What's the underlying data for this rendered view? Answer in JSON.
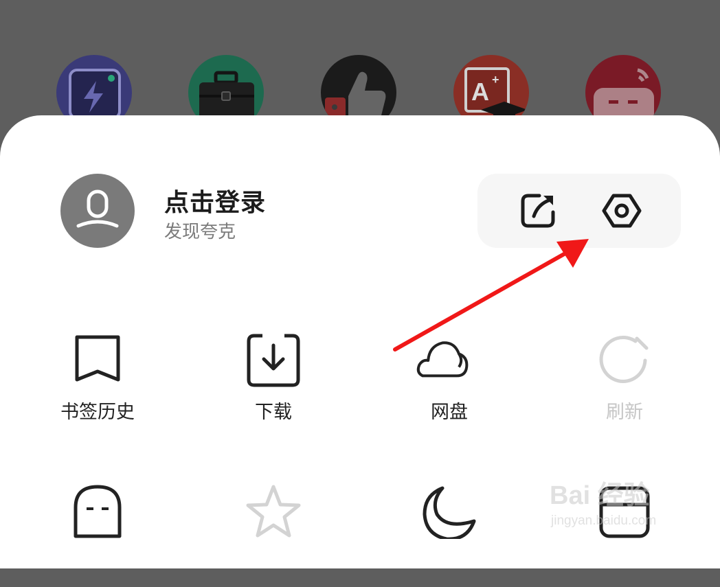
{
  "background_apps": [
    {
      "name": "flash-app-icon",
      "color": "#3a3a78"
    },
    {
      "name": "briefcase-app-icon",
      "color": "#1d6a4f"
    },
    {
      "name": "thumbs-up-app-icon",
      "color": "#1b1b1b"
    },
    {
      "name": "grade-app-icon",
      "color": "#8a2e25"
    },
    {
      "name": "tv-app-icon",
      "color": "#7a1a26"
    }
  ],
  "profile": {
    "title": "点击登录",
    "subtitle": "发现夸克"
  },
  "quick_actions": [
    {
      "icon": "share-export-icon"
    },
    {
      "icon": "settings-hex-icon"
    }
  ],
  "grid_row1": [
    {
      "label": "书签历史",
      "icon": "bookmark-icon",
      "enabled": true
    },
    {
      "label": "下载",
      "icon": "download-icon",
      "enabled": true
    },
    {
      "label": "网盘",
      "icon": "cloud-icon",
      "enabled": true
    },
    {
      "label": "刷新",
      "icon": "refresh-icon",
      "enabled": false
    }
  ],
  "grid_row2": [
    {
      "icon": "ghost-incognito-icon",
      "enabled": true
    },
    {
      "icon": "star-icon",
      "enabled": false
    },
    {
      "icon": "moon-icon",
      "enabled": true
    },
    {
      "icon": "window-icon",
      "enabled": true
    }
  ],
  "colors": {
    "overlay": "#5e5e5e",
    "sheet": "#ffffff",
    "annotation_arrow": "#f01818",
    "disabled_text": "#c6c6c6"
  },
  "watermark": {
    "line1": "Bai 经验",
    "line2": "jingyan.baidu.com"
  }
}
